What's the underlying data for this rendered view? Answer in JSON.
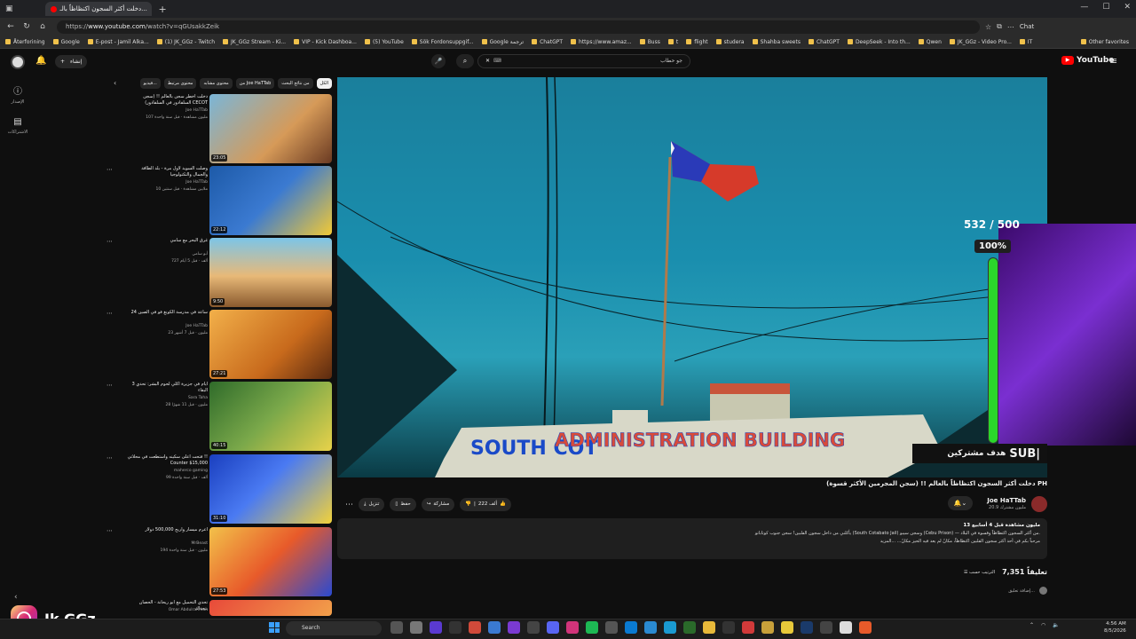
{
  "browser": {
    "tab_title": "دخلت أكثر السجون اكتظاظاً بالـ...",
    "url_prefix": "https://",
    "url_domain": "www.youtube.com",
    "url_path": "/watch?v=qGUsakkZeik",
    "chat_label": "Chat",
    "other_favorites": "Other favorites",
    "bookmarks": [
      "Återforining",
      "Google",
      "E-post - Jamil Alka...",
      "(1) JK_GGz - Twitch",
      "JK_GGz Stream - Ki...",
      "VIP - Kick Dashboa...",
      "(5) YouTube",
      "Sök Fordonsuppgif...",
      "Google ترجمة",
      "ChatGPT",
      "https://www.amaz...",
      "Buss",
      "t",
      "flight",
      "studera",
      "Shahba sweets",
      "ChatGPT",
      "DeepSeek - Into th...",
      "Qwen",
      "JK_GGz - Video Pro...",
      "IT"
    ]
  },
  "header": {
    "create_label": "إنشاء",
    "search_placeholder": "جو حطاب",
    "logo_text": "YouTube"
  },
  "left_rail": {
    "items": [
      {
        "label": "الإصدار"
      },
      {
        "label": "الاشتراكات"
      }
    ]
  },
  "chips": [
    "الكل",
    "من نتائج البحث",
    "من Joe HaTTab",
    "محتوى مشابه",
    "محتوى مرتبط",
    "فيديو..."
  ],
  "recommendations": [
    {
      "title": "دخلت أخطر سجن بالعالم !! (سجن السلفادور في السلفادور) CECOT",
      "channel": "Joe HaTTab",
      "meta": "107 مليون مشاهدة · قبل سنة واحدة",
      "duration": "23:05"
    },
    {
      "title": "وصلت السويد لأول مرة - بلد الطاقة والجمال والتكنولوجيا",
      "channel": "Joe HaTTab",
      "meta": "10 ملايين مشاهدة · قبل سنتين",
      "duration": "22:12"
    },
    {
      "title": "غرق البحر مع سامي",
      "channel": "أبو سامي",
      "meta": "727 ألف · قبل 5 أيام",
      "duration": "9:50"
    },
    {
      "title": "24 ساعة في مدرسة الكونغ فو في الصين",
      "channel": "Joe HaTTab",
      "meta": "23 مليون · قبل 7 أشهر",
      "duration": "27:21"
    },
    {
      "title": "3 أيام في جزيرة أكلي لحوم البشر: تحدي البقاء",
      "channel": "Sara Taha",
      "meta": "28 مليون · قبل 11 شهرًا",
      "duration": "40:15"
    },
    {
      "title": "فتحت أعلى سكينه واستطعت في محلاتي !! Counter $15,000",
      "channel": "maherco gaming",
      "meta": "99 ألف · قبل سنة واحدة",
      "duration": "31:10"
    },
    {
      "title": "أعرم ميسار وأربح 500,000 دولار",
      "channel": "MrBeast",
      "meta": "194 مليون · قبل سنة واحدة",
      "duration": "27:53"
    },
    {
      "title": "تحدي التحميل مع أبو ريحانة - الحصان يتحداك",
      "channel": "Omar Abdulrahman",
      "meta": "",
      "duration": ""
    }
  ],
  "player": {
    "sign_text_left": "SOUTH COT",
    "sign_text_main": "ADMINISTRATION BUILDING"
  },
  "stream_overlay": {
    "goal_text": "532 / 500",
    "goal_percent_label": "100%",
    "goal_fraction": 1.0,
    "sub_label": "SUB|",
    "sub_goal_label": "هدف مشتركين"
  },
  "video": {
    "title": "دخلت أكثر السجون اكتظاظاً بالعالم !! (سجن المجرمين الأكثر قسوة) PH",
    "likes": "222 ألف",
    "share_label": "مشاركة",
    "save_label": "حفظ",
    "download_label": "تنزيل",
    "channel_name": "Joe HaTTab",
    "channel_subs": "20.9 مليون مشترك",
    "description_stats": "13 مليون مشاهدة قبل 4 أسابيع",
    "description_line1": "يأكلني من داخل سجون الفلبين! سجن جنوب كوتاباتو (South Cotabato Jail) وسجن سيبو (Cebu Prison) — من أكثر السجون اكتظاظاً وقسوة في البلاد.",
    "description_line2": "مرحباً بكم في أحد أكثر سجون الفلبين اكتظاظاً، مكانٌ لم يعد فيه الحيز مكانٌ... ...المزيد",
    "comments_count": "7,351 تعليقاً",
    "sort_label": "الترتيب حسب",
    "add_comment_placeholder": "إضافة تعليق..."
  },
  "watermark": {
    "text": "Jk GGz"
  },
  "taskbar": {
    "search_label": "Search",
    "time": "4:56 AM",
    "date": "8/5/2026"
  }
}
